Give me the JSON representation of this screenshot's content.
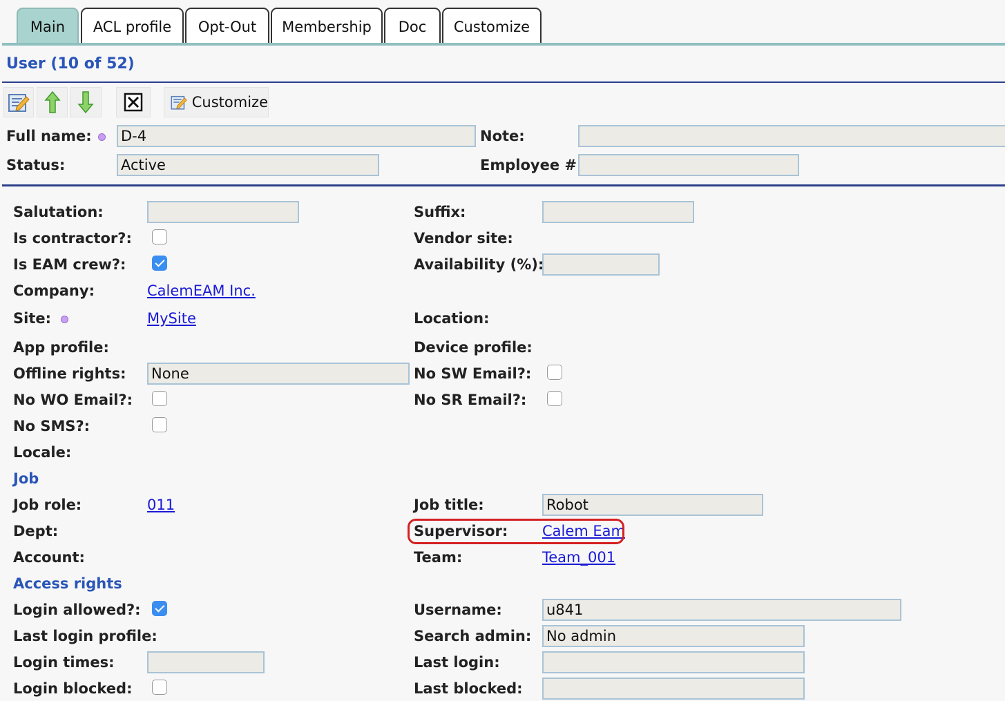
{
  "tabs": [
    {
      "label": "Main",
      "active": true
    },
    {
      "label": "ACL profile",
      "active": false
    },
    {
      "label": "Opt-Out",
      "active": false
    },
    {
      "label": "Membership",
      "active": false
    },
    {
      "label": "Doc",
      "active": false
    },
    {
      "label": "Customize",
      "active": false
    }
  ],
  "title": "User (10 of 52)",
  "toolbar": {
    "customize_label": "Customize",
    "icons": [
      "edit-icon",
      "arrow-up-icon",
      "arrow-down-icon",
      "close-icon",
      "customize-icon"
    ]
  },
  "header": {
    "full_name_label": "Full name:",
    "full_name_value": "D-4",
    "note_label": "Note:",
    "note_value": "",
    "status_label": "Status:",
    "status_value": "Active",
    "employee_label": "Employee #:",
    "employee_value": ""
  },
  "form": {
    "salutation_label": "Salutation:",
    "salutation_value": "",
    "suffix_label": "Suffix:",
    "suffix_value": "",
    "is_contractor_label": "Is contractor?:",
    "is_contractor": false,
    "vendor_site_label": "Vendor site:",
    "is_eam_crew_label": "Is EAM crew?:",
    "is_eam_crew": true,
    "availability_label": "Availability (%):",
    "availability_value": "",
    "company_label": "Company:",
    "company_value": "CalemEAM Inc.",
    "site_label": "Site:",
    "site_value": "MySite",
    "location_label": "Location:",
    "app_profile_label": "App profile:",
    "device_profile_label": "Device profile:",
    "offline_rights_label": "Offline rights:",
    "offline_rights_value": "None",
    "no_sw_email_label": "No SW Email?:",
    "no_sw_email": false,
    "no_wo_email_label": "No WO Email?:",
    "no_wo_email": false,
    "no_sr_email_label": "No SR Email?:",
    "no_sr_email": false,
    "no_sms_label": "No SMS?:",
    "no_sms": false,
    "locale_label": "Locale:"
  },
  "job": {
    "section_label": "Job",
    "job_role_label": "Job role:",
    "job_role_value": "011",
    "job_title_label": "Job title:",
    "job_title_value": "Robot",
    "dept_label": "Dept:",
    "supervisor_label": "Supervisor:",
    "supervisor_value": "Calem Eam",
    "account_label": "Account:",
    "team_label": "Team:",
    "team_value": "Team_001"
  },
  "access": {
    "section_label": "Access rights",
    "login_allowed_label": "Login allowed?:",
    "login_allowed": true,
    "username_label": "Username:",
    "username_value": "u841",
    "last_login_profile_label": "Last login profile:",
    "search_admin_label": "Search admin:",
    "search_admin_value": "No admin",
    "login_times_label": "Login times:",
    "login_times_value": "",
    "last_login_label": "Last login:",
    "last_login_value": "",
    "login_blocked_label": "Login blocked:",
    "login_blocked": false,
    "last_blocked_label": "Last blocked:",
    "last_blocked_value": ""
  },
  "colors": {
    "tab_active": "#a9d3cf",
    "section_title": "#2a55b8",
    "link": "#1a1ad6",
    "highlight": "#d42020"
  }
}
